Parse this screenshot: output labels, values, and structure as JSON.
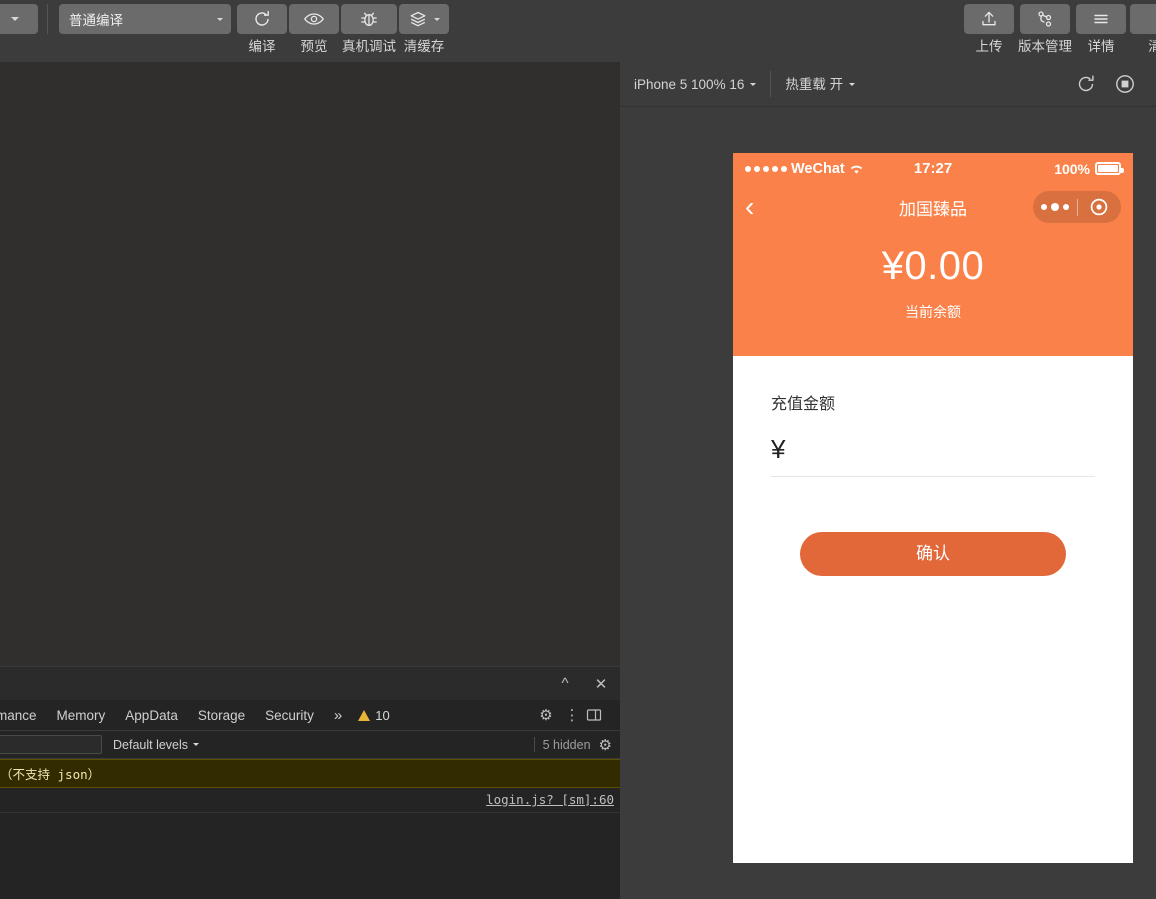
{
  "toolbar": {
    "left_dropdown_icon": "caret-down-icon",
    "compile_mode": {
      "value": "普通编译",
      "icon": "chevron-down-icon"
    },
    "items": [
      {
        "label": "编译",
        "icon": "refresh-icon"
      },
      {
        "label": "预览",
        "icon": "eye-icon"
      },
      {
        "label": "真机调试",
        "icon": "bug-icon"
      },
      {
        "label": "清缓存",
        "icon": "layers-icon"
      }
    ],
    "right_items": [
      {
        "label": "上传",
        "icon": "upload-icon"
      },
      {
        "label": "版本管理",
        "icon": "branch-icon"
      },
      {
        "label": "详情",
        "icon": "hamburger-icon"
      },
      {
        "label": "清",
        "icon": "more-icon"
      }
    ]
  },
  "simulator": {
    "device_selector": {
      "label": "iPhone 5 100% 16",
      "icon": "chevron-down-icon"
    },
    "hot_reload": {
      "label": "热重载 开",
      "icon": "chevron-down-icon"
    },
    "actions": [
      {
        "name": "refresh",
        "icon": "refresh-circle-icon"
      },
      {
        "name": "stop",
        "icon": "stop-record-icon"
      }
    ],
    "phone": {
      "status_bar": {
        "carrier": "WeChat",
        "signal_icon": "signal-dots-icon",
        "wifi_icon": "wifi-icon",
        "time": "17:27",
        "battery_percent": "100%",
        "battery_icon": "battery-full-icon"
      },
      "nav": {
        "back_icon": "chevron-left-icon",
        "title": "加国臻品",
        "capsule": {
          "more_icon": "more-dots-icon",
          "target_icon": "target-circle-icon"
        }
      },
      "balance": {
        "amount": "¥0.00",
        "label": "当前余额"
      },
      "form": {
        "field_label": "充值金额",
        "currency_symbol": "¥",
        "amount_value": "",
        "amount_placeholder": "",
        "confirm_label": "确认"
      },
      "theme": {
        "header_color": "#FA8149",
        "button_color": "#E2683A"
      }
    }
  },
  "devtools": {
    "window_controls": {
      "collapse_icon": "chevron-up-icon",
      "close_icon": "close-icon"
    },
    "tabs": [
      {
        "label": "mance"
      },
      {
        "label": "Memory"
      },
      {
        "label": "AppData"
      },
      {
        "label": "Storage"
      },
      {
        "label": "Security"
      }
    ],
    "overflow_icon": "double-chevron-right-icon",
    "warning_badge": {
      "icon": "warning-triangle-icon",
      "count": "10"
    },
    "tools": [
      {
        "name": "settings",
        "icon": "gear-icon"
      },
      {
        "name": "menu",
        "icon": "kebab-menu-icon"
      },
      {
        "name": "dock",
        "icon": "dock-panel-icon"
      }
    ],
    "filter_bar": {
      "filter_value": "",
      "filter_placeholder": "",
      "levels_label": "Default levels",
      "levels_icon": "chevron-down-icon",
      "hidden_label": "5 hidden",
      "settings_icon": "gear-icon"
    },
    "console_messages": [
      {
        "type": "warning",
        "text": "（不支持 json）",
        "source": "login.js? [sm]:60"
      }
    ]
  }
}
